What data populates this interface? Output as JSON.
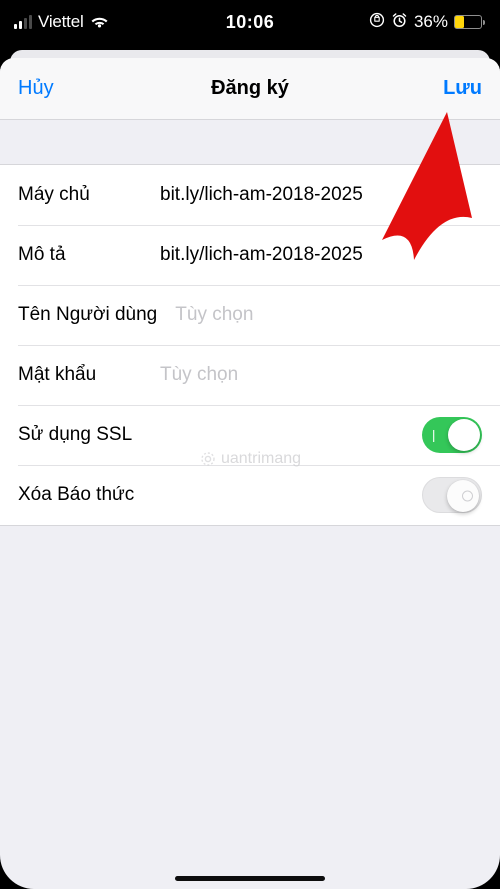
{
  "status_bar": {
    "carrier": "Viettel",
    "time": "10:06",
    "battery_pct": "36%",
    "battery_level_pct": 36
  },
  "navbar": {
    "cancel": "Hủy",
    "title": "Đăng ký",
    "save": "Lưu"
  },
  "form": {
    "server": {
      "label": "Máy chủ",
      "value": "bit.ly/lich-am-2018-2025"
    },
    "description": {
      "label": "Mô tả",
      "value": "bit.ly/lich-am-2018-2025"
    },
    "username": {
      "label": "Tên Người dùng",
      "placeholder": "Tùy chọn",
      "value": ""
    },
    "password": {
      "label": "Mật khẩu",
      "placeholder": "Tùy chọn",
      "value": ""
    },
    "use_ssl": {
      "label": "Sử dụng SSL",
      "checked": true
    },
    "remove_alarms": {
      "label": "Xóa Báo thức",
      "checked": false
    }
  },
  "watermark": "uantrimang"
}
